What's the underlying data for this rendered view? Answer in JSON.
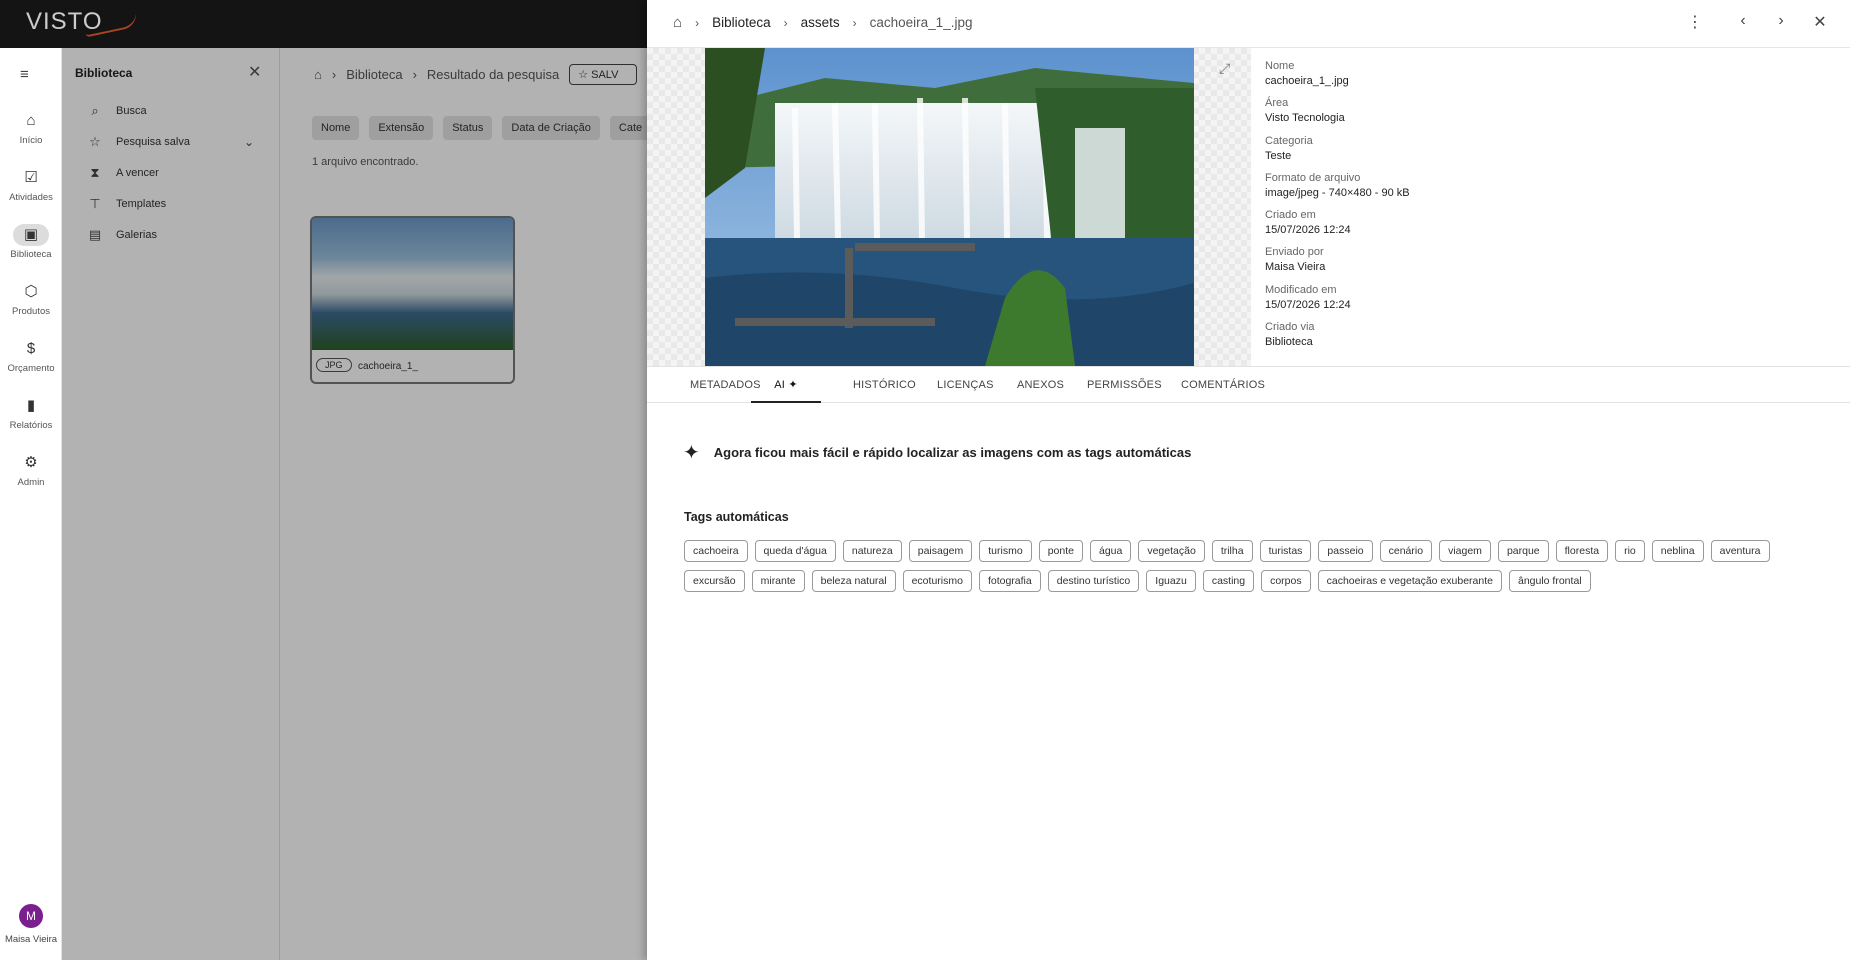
{
  "app": {
    "logo": "VISTO"
  },
  "rail": {
    "items": [
      {
        "label": "Início",
        "icon": "home-icon",
        "glyph": "⌂"
      },
      {
        "label": "Atividades",
        "icon": "checkbox-icon",
        "glyph": "☑"
      },
      {
        "label": "Biblioteca",
        "icon": "library-icon",
        "glyph": "▣"
      },
      {
        "label": "Produtos",
        "icon": "box-icon",
        "glyph": "⬡"
      },
      {
        "label": "Orçamento",
        "icon": "dollar-icon",
        "glyph": "$"
      },
      {
        "label": "Relatórios",
        "icon": "bar-chart-icon",
        "glyph": "▮"
      },
      {
        "label": "Admin",
        "icon": "gear-icon",
        "glyph": "⚙"
      }
    ],
    "user": {
      "initial": "M",
      "name": "Maisa Vieira"
    }
  },
  "sidepanel": {
    "title": "Biblioteca",
    "items": [
      {
        "label": "Busca",
        "glyph": "⌕"
      },
      {
        "label": "Pesquisa salva",
        "glyph": "☆"
      },
      {
        "label": "A vencer",
        "glyph": "⧗"
      },
      {
        "label": "Templates",
        "glyph": "⊤"
      },
      {
        "label": "Galerias",
        "glyph": "▤"
      }
    ]
  },
  "main": {
    "breadcrumb": [
      "Biblioteca",
      "Resultado da pesquisa"
    ],
    "save_label": "SALV",
    "filters": [
      "Nome",
      "Extensão",
      "Status",
      "Data de Criação",
      "Cate"
    ],
    "found_text": "1 arquivo encontrado.",
    "card": {
      "type": "JPG",
      "name": "cachoeira_1_"
    }
  },
  "drawer": {
    "breadcrumb": {
      "b1": "Biblioteca",
      "b2": "assets",
      "current": "cachoeira_1_.jpg"
    },
    "metadata": [
      {
        "k": "Nome",
        "v": "cachoeira_1_.jpg"
      },
      {
        "k": "Área",
        "v": "Visto Tecnologia"
      },
      {
        "k": "Categoria",
        "v": "Teste"
      },
      {
        "k": "Formato de arquivo",
        "v": "image/jpeg - 740×480 - 90 kB"
      },
      {
        "k": "Criado em",
        "v": "15/07/2026 12:24"
      },
      {
        "k": "Enviado por",
        "v": "Maisa Vieira"
      },
      {
        "k": "Modificado em",
        "v": "15/07/2026 12:24"
      },
      {
        "k": "Criado via",
        "v": "Biblioteca"
      }
    ],
    "tabs": [
      "METADADOS",
      "AI",
      "HISTÓRICO",
      "LICENÇAS",
      "ANEXOS",
      "PERMISSÕES",
      "COMENTÁRIOS"
    ],
    "active_tab": "AI",
    "ai_headline": "Agora ficou mais fácil e rápido localizar as imagens com as tags automáticas",
    "tags_title": "Tags automáticas",
    "tags": [
      "cachoeira",
      "queda d'água",
      "natureza",
      "paisagem",
      "turismo",
      "ponte",
      "água",
      "vegetação",
      "trilha",
      "turistas",
      "passeio",
      "cenário",
      "viagem",
      "parque",
      "floresta",
      "rio",
      "neblina",
      "aventura",
      "excursão",
      "mirante",
      "beleza natural",
      "ecoturismo",
      "fotografia",
      "destino turístico",
      "Iguazu",
      "casting",
      "corpos",
      "cachoeiras e vegetação exuberante",
      "ângulo frontal"
    ]
  }
}
